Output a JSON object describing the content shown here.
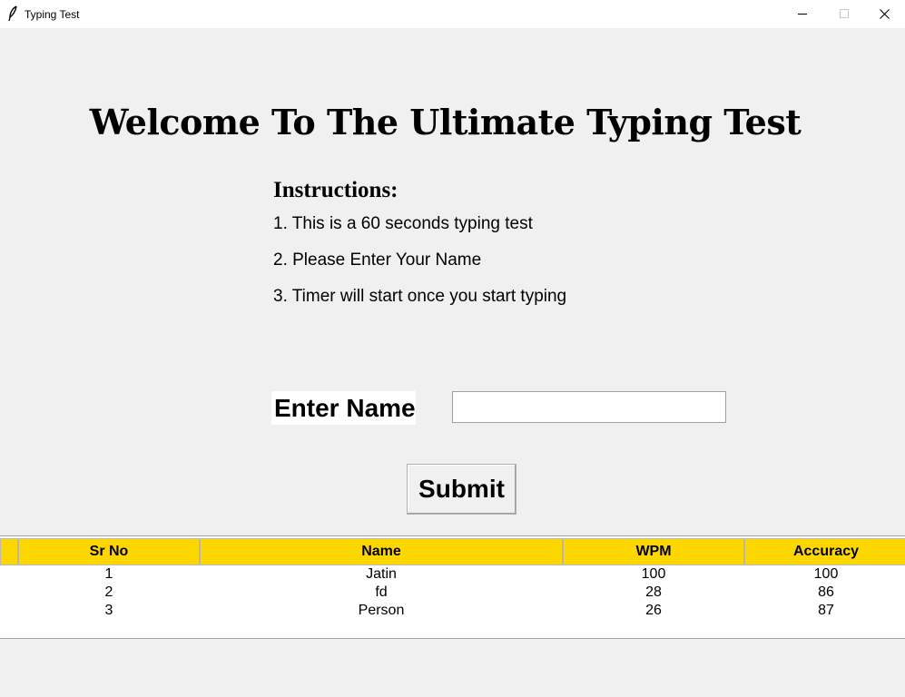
{
  "window": {
    "title": "Typing Test",
    "icon": "feather-icon",
    "controls": [
      "minimize-icon",
      "maximize-icon",
      "close-icon"
    ]
  },
  "main": {
    "heading": "Welcome To The Ultimate Typing Test",
    "instructions_title": "Instructions:",
    "instructions": [
      "1. This is a 60 seconds typing test",
      "2. Please Enter Your Name",
      "3. Timer will start once you start typing"
    ],
    "name_label": "Enter Name",
    "name_value": "",
    "submit_label": "Submit"
  },
  "table": {
    "header_color": "#ffd700",
    "columns": [
      "Sr No",
      "Name",
      "WPM",
      "Accuracy"
    ],
    "rows": [
      [
        "1",
        "Jatin",
        "100",
        "100"
      ],
      [
        "2",
        "fd",
        "28",
        "86"
      ],
      [
        "3",
        "Person",
        "26",
        "87"
      ]
    ]
  }
}
